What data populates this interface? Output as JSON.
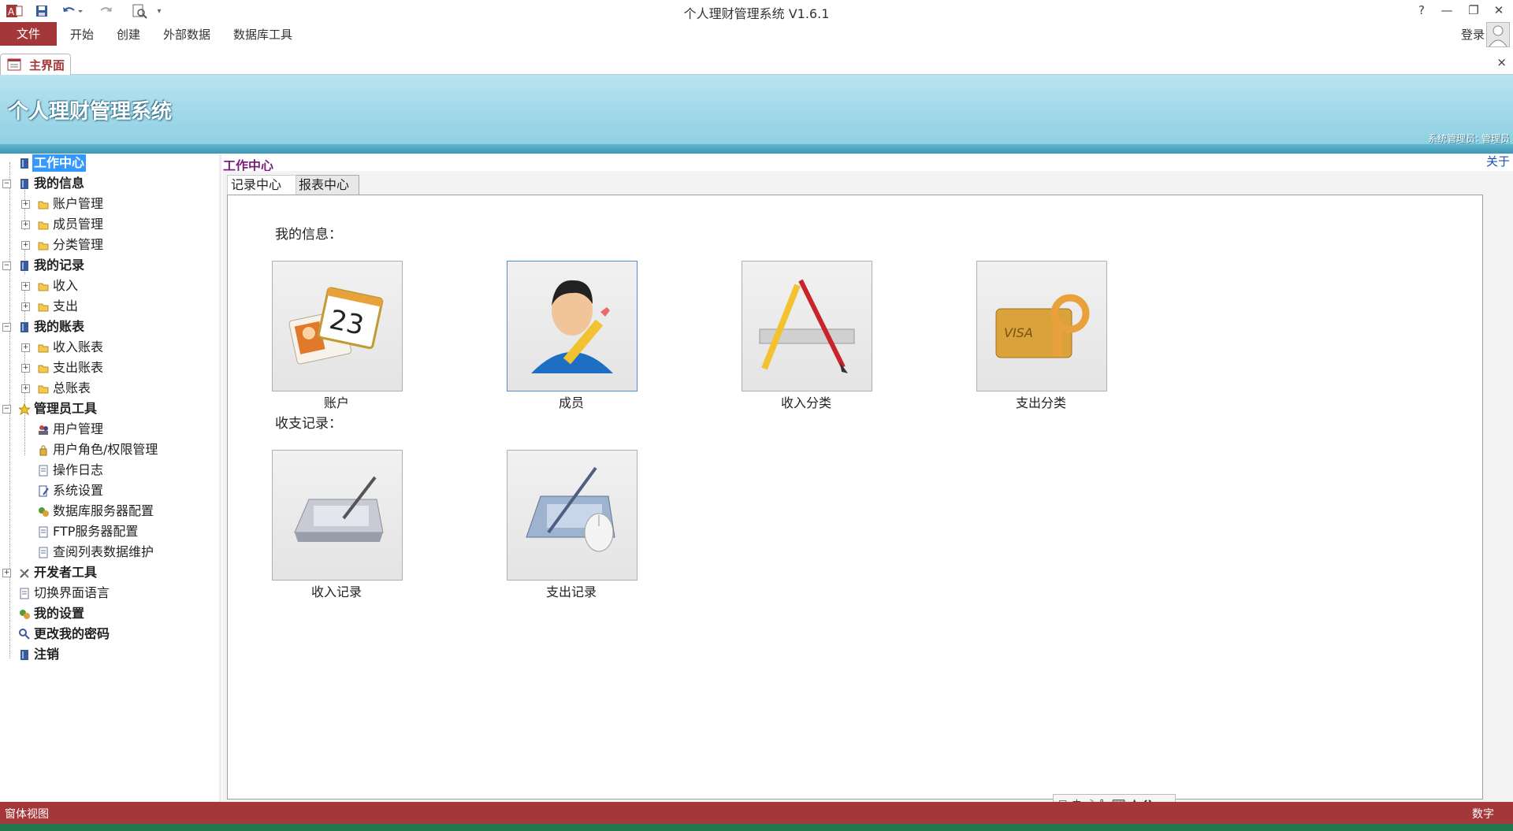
{
  "window": {
    "title": "个人理财管理系统 V1.6.1",
    "help": "?",
    "minimize": "—",
    "restore": "❐",
    "close": "✕"
  },
  "ribbon": {
    "file": "文件",
    "tabs": [
      "开始",
      "创建",
      "外部数据",
      "数据库工具"
    ],
    "login": "登录"
  },
  "doc_tab": {
    "label": "主界面",
    "close": "×"
  },
  "header": {
    "title": "个人理财管理系统",
    "user": "系统管理员: 管理员"
  },
  "tree": {
    "work_center": "工作中心",
    "my_info": "我的信息",
    "account_mgmt": "账户管理",
    "member_mgmt": "成员管理",
    "category_mgmt": "分类管理",
    "my_records": "我的记录",
    "income": "收入",
    "expense": "支出",
    "my_reports": "我的账表",
    "income_report": "收入账表",
    "expense_report": "支出账表",
    "general_report": "总账表",
    "admin_tools": "管理员工具",
    "user_mgmt": "用户管理",
    "role_perm": "用户角色/权限管理",
    "op_log": "操作日志",
    "sys_settings": "系统设置",
    "db_server": "数据库服务器配置",
    "ftp_server": "FTP服务器配置",
    "lookup_maint": "查阅列表数据维护",
    "dev_tools": "开发者工具",
    "switch_lang": "切换界面语言",
    "my_settings": "我的设置",
    "change_pwd": "更改我的密码",
    "logout": "注销"
  },
  "main": {
    "crumb": "工作中心",
    "about": "关于",
    "tabs": {
      "records": "记录中心",
      "reports": "报表中心"
    },
    "sec_info": "我的信息：",
    "sec_records": "收支记录：",
    "tiles": {
      "account": "账户",
      "member": "成员",
      "income_cat": "收入分类",
      "expense_cat": "支出分类",
      "income_rec": "收入记录",
      "expense_rec": "支出记录"
    },
    "calendar_day": "23",
    "visa": "VISA"
  },
  "status": {
    "left": "窗体视图",
    "right": "数字",
    "ime_lang": "中"
  },
  "colors": {
    "accent": "#a4373a",
    "banner": "#8fd0e4",
    "link": "#1a4fb0",
    "selection": "#3399ff"
  }
}
